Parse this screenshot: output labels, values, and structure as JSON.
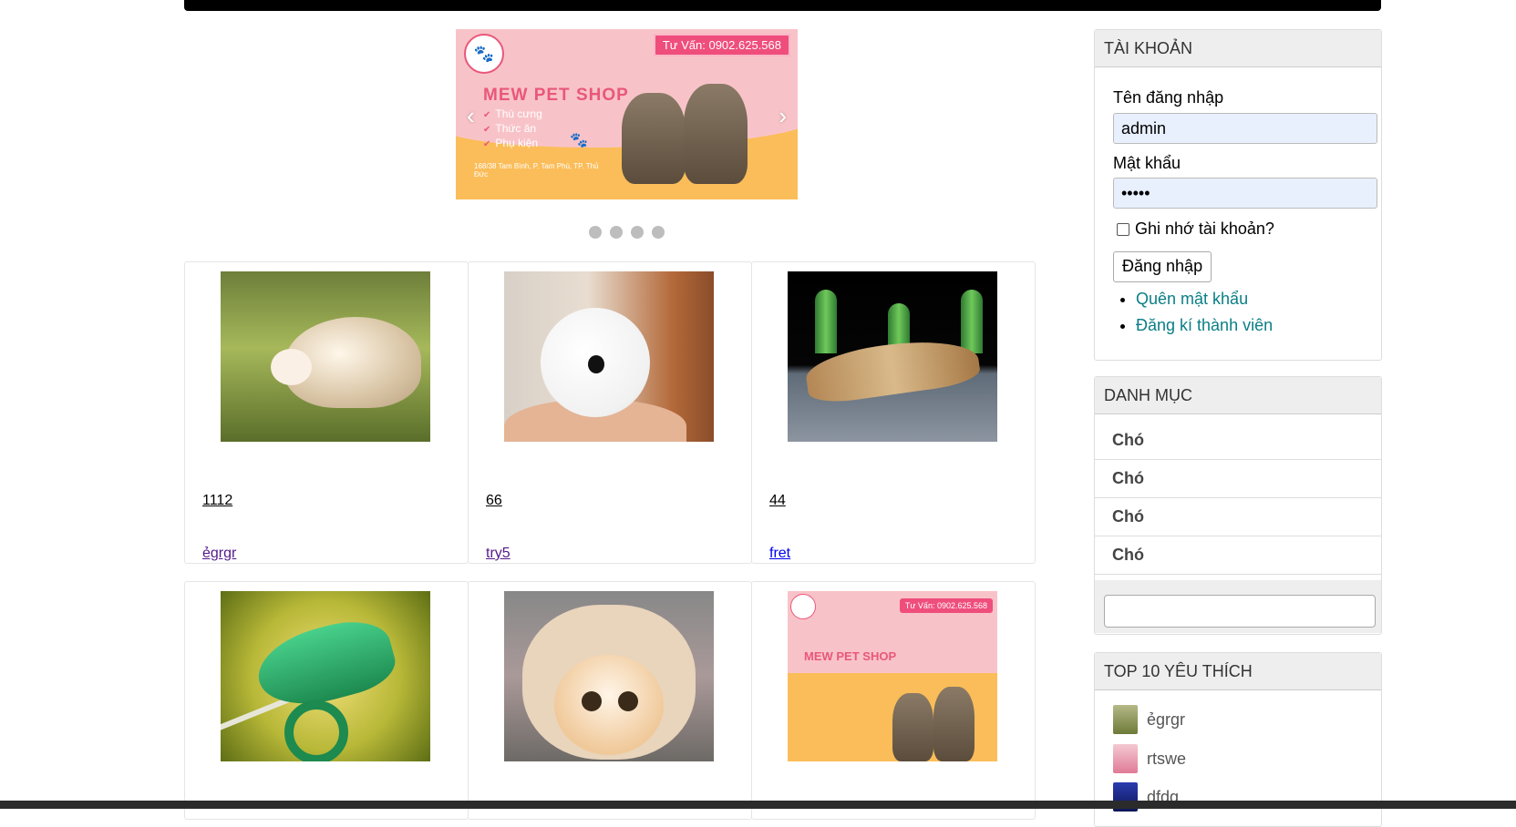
{
  "carousel": {
    "hotline": "Tư Vấn: 0902.625.568",
    "shop_name": "MEW PET SHOP",
    "services": [
      "Thú cưng",
      "Thức ăn",
      "Phụ kiện"
    ],
    "address": "168/38 Tam Bình, P. Tam Phú, TP. Thủ Đức",
    "prev_label": "‹",
    "next_label": "›",
    "slide_count": 4
  },
  "products": [
    {
      "name": "1112",
      "category": "ẻgrgr",
      "image": "hedgehog"
    },
    {
      "name": "66",
      "category": "try5",
      "image": "bunny"
    },
    {
      "name": "44",
      "category": "fret",
      "image": "lizard"
    },
    {
      "name": "",
      "category": "",
      "image": "chameleon"
    },
    {
      "name": "",
      "category": "",
      "image": "cat"
    },
    {
      "name": "",
      "category": "",
      "image": "shop-banner"
    }
  ],
  "mini_banner": {
    "hotline": "Tư Vấn: 0902.625.568",
    "shop_name": "MEW PET SHOP"
  },
  "account": {
    "title": "TÀI KHOẢN",
    "username_label": "Tên đăng nhập",
    "username_value": "admin",
    "password_label": "Mật khẩu",
    "password_value": "•••••",
    "remember_label": "Ghi nhớ tài khoản?",
    "login_button": "Đăng nhập",
    "forgot_link": "Quên mật khẩu",
    "register_link": "Đăng kí thành viên"
  },
  "categories": {
    "title": "DANH MỤC",
    "items": [
      "Chó",
      "Chó",
      "Chó",
      "Chó"
    ],
    "search_value": ""
  },
  "top10": {
    "title": "TOP 10 YÊU THÍCH",
    "items": [
      {
        "name": "ẻgrgr",
        "thumb_color": "#8a8f4a"
      },
      {
        "name": "rtswe",
        "thumb_color": "#e89aa6"
      },
      {
        "name": "dfdg",
        "thumb_color": "#1a2a8a"
      }
    ]
  }
}
